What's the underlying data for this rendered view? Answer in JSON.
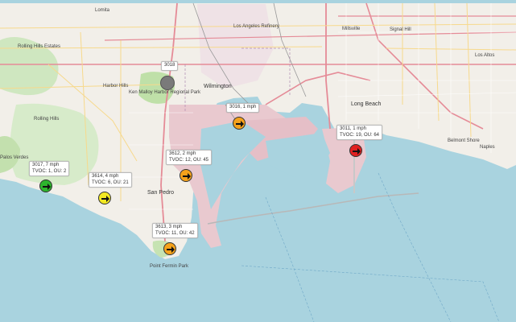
{
  "map": {
    "places": [
      {
        "id": "lomita",
        "name": "Lomita"
      },
      {
        "id": "rolling-hills-estates",
        "name": "Rolling Hills Estates"
      },
      {
        "id": "harbor-hills",
        "name": "Harbor Hills"
      },
      {
        "id": "rolling-hills",
        "name": "Rolling Hills"
      },
      {
        "id": "wilmington",
        "name": "Wilmington"
      },
      {
        "id": "san-pedro",
        "name": "San Pedro"
      },
      {
        "id": "long-beach",
        "name": "Long Beach"
      },
      {
        "id": "signal-hill",
        "name": "Signal Hill"
      },
      {
        "id": "millsville",
        "name": "Millsville"
      },
      {
        "id": "los-altos",
        "name": "Los Altos"
      },
      {
        "id": "belmont-shore",
        "name": "Belmont Shore"
      },
      {
        "id": "naples",
        "name": "Naples"
      },
      {
        "id": "palos-verdes",
        "name": "Palos Verdes"
      },
      {
        "id": "los-angeles-refinery",
        "name": "Los Angeles Refinery"
      },
      {
        "id": "point-fermin",
        "name": "Point Fermin Park"
      },
      {
        "id": "ken-malloy",
        "name": "Ken Malloy Harbor Regional Park"
      }
    ],
    "stations": [
      {
        "id": "3018",
        "label_line1": "3018",
        "label_line2": "",
        "marker_color": "#7a7a7a",
        "icon": "none-circle"
      },
      {
        "id": "3016",
        "label_line1": "3016, 1 mph",
        "label_line2": "",
        "marker_color": "#f5a21b",
        "icon": "arrow-right-icon"
      },
      {
        "id": "3011",
        "label_line1": "3011, 1 mph",
        "label_line2": "TVOC: 19, OU: 64",
        "marker_color": "#e02020",
        "icon": "arrow-right-icon"
      },
      {
        "id": "3012",
        "label_line1": "3612, 2 mph",
        "label_line2": "TVOC: 12, OU: 45",
        "marker_color": "#f5a21b",
        "icon": "arrow-right-icon"
      },
      {
        "id": "3017",
        "label_line1": "3017, 7 mph",
        "label_line2": "TVOC: 1, OU: 2",
        "marker_color": "#2db52d",
        "icon": "arrow-right-icon"
      },
      {
        "id": "3014",
        "label_line1": "3614, 4 mph",
        "label_line2": "TVOC: 6, OU: 21",
        "marker_color": "#f2e822",
        "icon": "arrow-right-icon"
      },
      {
        "id": "3013",
        "label_line1": "3613, 3 mph",
        "label_line2": "TVOC: 11, OU: 42",
        "marker_color": "#f5a21b",
        "icon": "arrow-right-icon"
      }
    ],
    "colors": {
      "water": "#a9d3df",
      "land": "#f2efe9",
      "port": "#e9c9cf",
      "park": "#c8e6b5",
      "major_road": "#e58b97",
      "secondary_road": "#f7d98c"
    }
  }
}
